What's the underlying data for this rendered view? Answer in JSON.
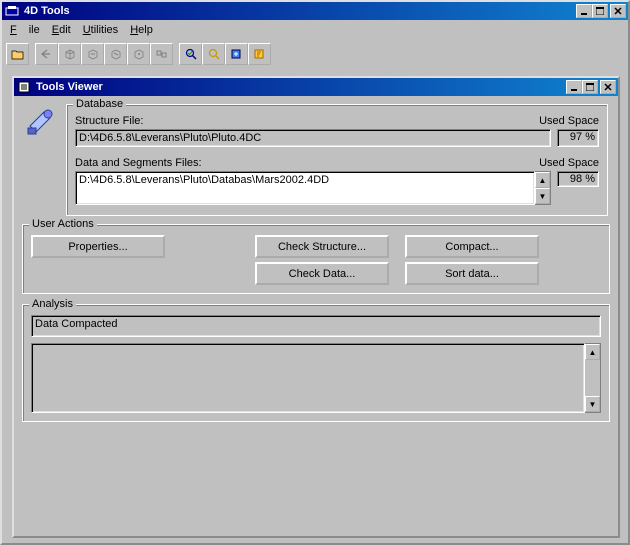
{
  "window": {
    "title": "4D Tools"
  },
  "menubar": {
    "file": "File",
    "edit": "Edit",
    "utilities": "Utilities",
    "help": "Help"
  },
  "viewer": {
    "title": "Tools Viewer"
  },
  "database": {
    "legend": "Database",
    "structure_label": "Structure File:",
    "used_space_label": "Used Space",
    "structure_path": "D:\\4D6.5.8\\Leverans\\Pluto\\Pluto.4DC",
    "structure_used": "97 %",
    "data_label": "Data and Segments Files:",
    "data_items": [
      "D:\\4D6.5.8\\Leverans\\Pluto\\Databas\\Mars2002.4DD"
    ],
    "data_used": "98 %"
  },
  "user_actions": {
    "legend": "User Actions",
    "properties": "Properties...",
    "check_structure": "Check Structure...",
    "compact": "Compact...",
    "check_data": "Check Data...",
    "sort_data": "Sort data..."
  },
  "analysis": {
    "legend": "Analysis",
    "status": "Data Compacted"
  }
}
